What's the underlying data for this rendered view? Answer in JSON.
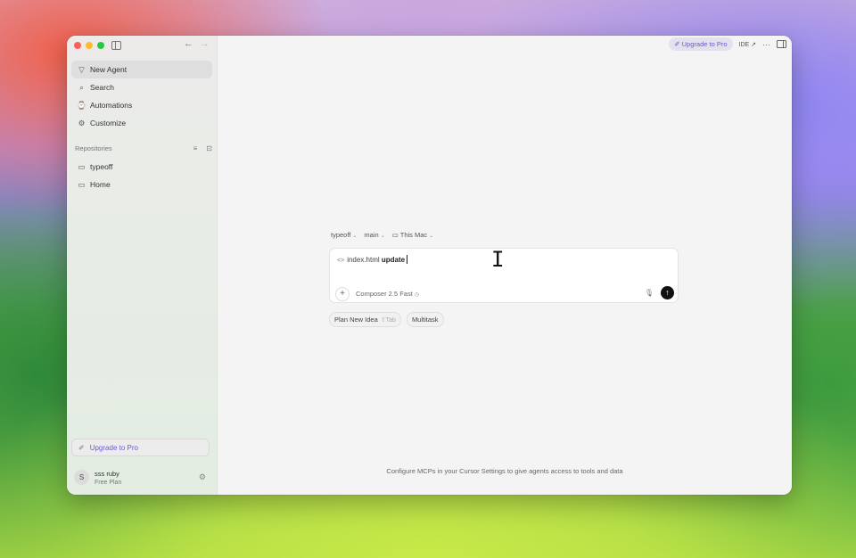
{
  "sidebar": {
    "menu": [
      {
        "label": "New Agent",
        "icon": "agent-icon",
        "active": true
      },
      {
        "label": "Search",
        "icon": "search-icon"
      },
      {
        "label": "Automations",
        "icon": "automations-icon"
      },
      {
        "label": "Customize",
        "icon": "customize-icon"
      }
    ],
    "repositories_label": "Repositories",
    "repositories": [
      {
        "label": "typeoff",
        "icon": "folder-icon"
      },
      {
        "label": "Home",
        "icon": "folder-icon"
      }
    ],
    "upgrade_label": "Upgrade to Pro",
    "user": {
      "initial": "S",
      "name": "sss ruby",
      "plan": "Free Plan"
    }
  },
  "topbar": {
    "upgrade_label": "Upgrade to Pro",
    "ide_label": "IDE ↗",
    "more_label": "···"
  },
  "context": {
    "repo": "typeoff",
    "branch": "main",
    "machine": "This Mac"
  },
  "composer": {
    "file_ref": "index.html",
    "typed": "update",
    "model": "Composer 2.5 Fast"
  },
  "chips": {
    "plan_label": "Plan New Idea",
    "plan_shortcut": "⇧Tab",
    "multitask_label": "Multitask"
  },
  "footer_note": "Configure MCPs in your Cursor Settings to give agents access to tools and data",
  "colors": {
    "accent": "#6b5ac8",
    "send_button": "#111111"
  }
}
